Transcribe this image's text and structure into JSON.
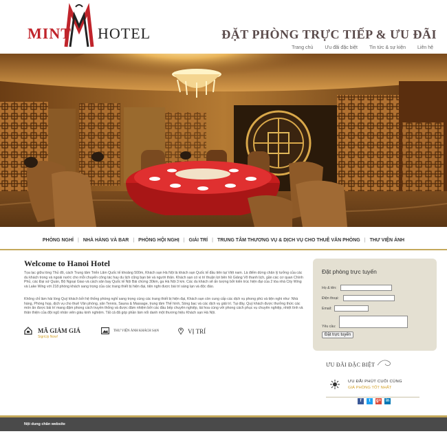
{
  "brand": {
    "logo_left": "MINT",
    "logo_right": "HOTEL"
  },
  "header": {
    "headline": "ĐẶT PHÒNG TRỰC TIẾP & ƯU ĐÃI",
    "topnav": [
      "Trang chủ",
      "Ưu đãi đặc biệt",
      "Tin tức & sự kiện",
      "Liên hệ"
    ]
  },
  "mainnav": [
    "PHÒNG NGHỈ",
    "NHÀ HÀNG VÀ BAR",
    "PHÒNG HỘI NGHỊ",
    "GIẢI TRÍ",
    "TRUNG TÂM THƯƠNG VỤ & DỊCH VỤ CHO THUÊ VĂN PHÒNG",
    "THƯ VIỆN ẢNH"
  ],
  "welcome": {
    "title": "Welcome to Hanoi Hotel",
    "para1": "Tọa lạc giữa lòng Thủ đô, cách Trung tâm Triển Lãm Quốc tế khoảng 500m, Khách sạn Hà Nội là khách sạn Quốc tế đầu tiên tại Việt nam. Là điểm dừng chân lý tưởng của các du khách trong và ngoài nước cho mỗi chuyến công tác hay du lịch cũng bạn bè và người thân. Khách sạn có vị trí thuận lợi bên hồ Giảng Võ thanh lịch, gần các cơ quan Chính Phủ, các Đại sứ Quán, Bộ Ngoại Giao và cách sân bay Quốc tế Nội Bài chừng 30km, ga Hà Nội 3 km. Các du khách sẽ ấn tượng bởi kiến trúc hiện đại của 2 tòa nhà City Wing và Lake Wing với 218 phòng khách sang trọng của các trang thiết bị hiện đại, tiện nghi được bài trí sáng lạn và độc đáo.",
    "para2": "Không chỉ làm hài lòng Quý khách bởi hệ thống phòng nghỉ sang trọng cùng các trang thiết bị hiện đại, Khách sạn còn cung cấp các dịch vụ phong phú và tiện nghi như: Nhà hàng, Phòng họp, dịch vụ cho thuê Văn phòng, sân Tennis, Sauna & Massage, trung tâm Thể hình, Sòng bạc và các dịch vụ giải trí. Tại đây, Quý khách được thưởng thức các món ăn được bài trí mang đậm phong cách truyền thống và được đảm nhiệm bởi các đầu bếp chuyên nghiệp, tài hoa cùng với phong cách phục vụ chuyên nghiệp, nhiệt tình và thân thiện của đội ngũ nhân viên giàu kinh nghiệm. Tất cả đã góp phần làm nổi danh một thương hiệu Khách sạn Hà Nội."
  },
  "quick_links": {
    "coupon_title": "MÃ GIẢM GIÁ",
    "coupon_sub": "SignUp Now!",
    "gallery": "THƯ VIỆN ẢNH KHÁCH SẠN",
    "location": "VỊ TRÍ"
  },
  "booking": {
    "title": "Đặt phòng trực tuyến",
    "labels": [
      "Họ & tên:",
      "Điện thoại:",
      "Email:",
      "Yêu cầu:"
    ],
    "submit": "Đặt trực tuyến"
  },
  "offers": {
    "title": "ƯU ĐÃI ĐẶC BIỆT",
    "line1": "ƯU ĐÃI PHÚT CUỐI CÙNG",
    "line2": "GIÁ PHÒNG TỐT NHẤT"
  },
  "social": [
    "f",
    "t",
    "g+",
    "in"
  ],
  "colors": {
    "brand_red": "#c0242b",
    "gold": "#c4a85a",
    "footer_bg": "#4a4a4a",
    "panel_bg": "#e4e0d2"
  },
  "footer": {
    "text": "Nội dung chân website"
  }
}
